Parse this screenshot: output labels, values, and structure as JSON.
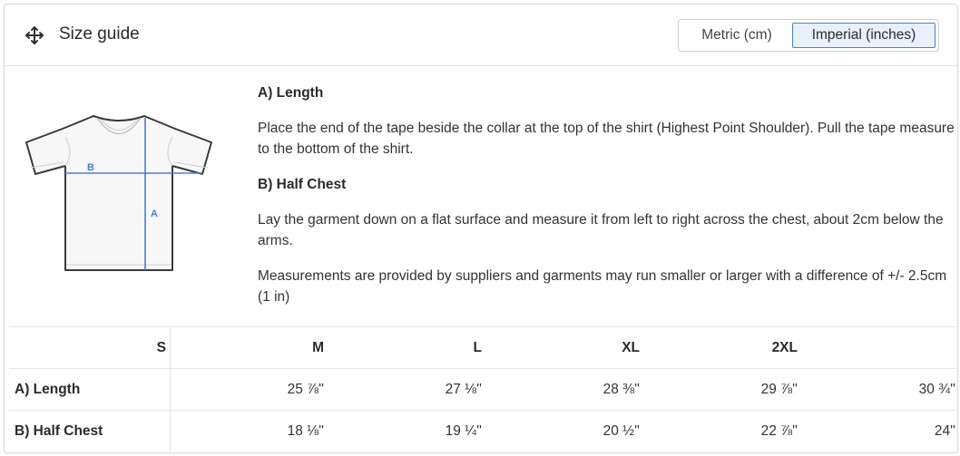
{
  "header": {
    "title": "Size guide",
    "units": {
      "metric_label": "Metric (cm)",
      "imperial_label": "Imperial (inches)",
      "selected": "imperial"
    },
    "accent_color": "#4c7fd6"
  },
  "figure": {
    "label_a": "A",
    "label_b": "B"
  },
  "info": {
    "length_heading": "A) Length",
    "length_text": "Place the end of the tape beside the collar at the top of the shirt (Highest Point Shoulder). Pull the tape measure to the bottom of the shirt.",
    "chest_heading": "B) Half Chest",
    "chest_text": "Lay the garment down on a flat surface and measure it from left to right across the chest, about 2cm below the arms.",
    "disclaimer": "Measurements are provided by suppliers and garments may run smaller or larger with a difference of +/- 2.5cm (1 in)"
  },
  "size_table": {
    "sizes": [
      "S",
      "M",
      "L",
      "XL",
      "2XL"
    ],
    "rows": [
      {
        "label": "A) Length",
        "values": [
          "25 ⅞''",
          "27 ⅛''",
          "28 ⅜''",
          "29 ⅞''",
          "30 ¾''"
        ]
      },
      {
        "label": "B) Half Chest",
        "values": [
          "18 ⅛''",
          "19 ¼''",
          "20 ½''",
          "22 ⅞''",
          "24''"
        ]
      }
    ]
  }
}
